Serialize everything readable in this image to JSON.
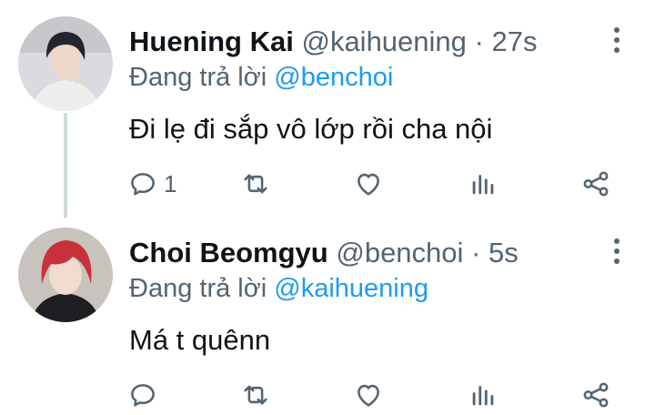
{
  "tweets": [
    {
      "name": "Huening Kai",
      "handle": "@kaihuening",
      "separator": "·",
      "time": "27s",
      "reply_prefix": "Đang trả lời",
      "reply_to": "@benchoi",
      "text": "Đi lẹ đi sắp vô lớp rồi cha nội",
      "reply_count": "1",
      "avatar_colors": {
        "bg": "#d9dbe0",
        "hair": "#23262d",
        "face": "#ecd7c9",
        "clothes": "#eeeeee"
      }
    },
    {
      "name": "Choi Beomgyu",
      "handle": "@benchoi",
      "separator": "·",
      "time": "5s",
      "reply_prefix": "Đang trả lời",
      "reply_to": "@kaihuening",
      "text": "Má t quênn",
      "reply_count": "",
      "avatar_colors": {
        "bg": "#c9c3bd",
        "hair": "#c8313a",
        "face": "#f1dbce",
        "clothes": "#1f1f23"
      }
    }
  ],
  "icons": {
    "reply": "comment-icon",
    "retweet": "retweet-icon",
    "like": "heart-icon",
    "stats": "bar-chart-icon",
    "share": "share-icon",
    "more": "more-vertical-icon"
  },
  "colors": {
    "text": "#0f1419",
    "secondary": "#536471",
    "link": "#1d9bf0",
    "thread_line": "#cfd9de"
  }
}
